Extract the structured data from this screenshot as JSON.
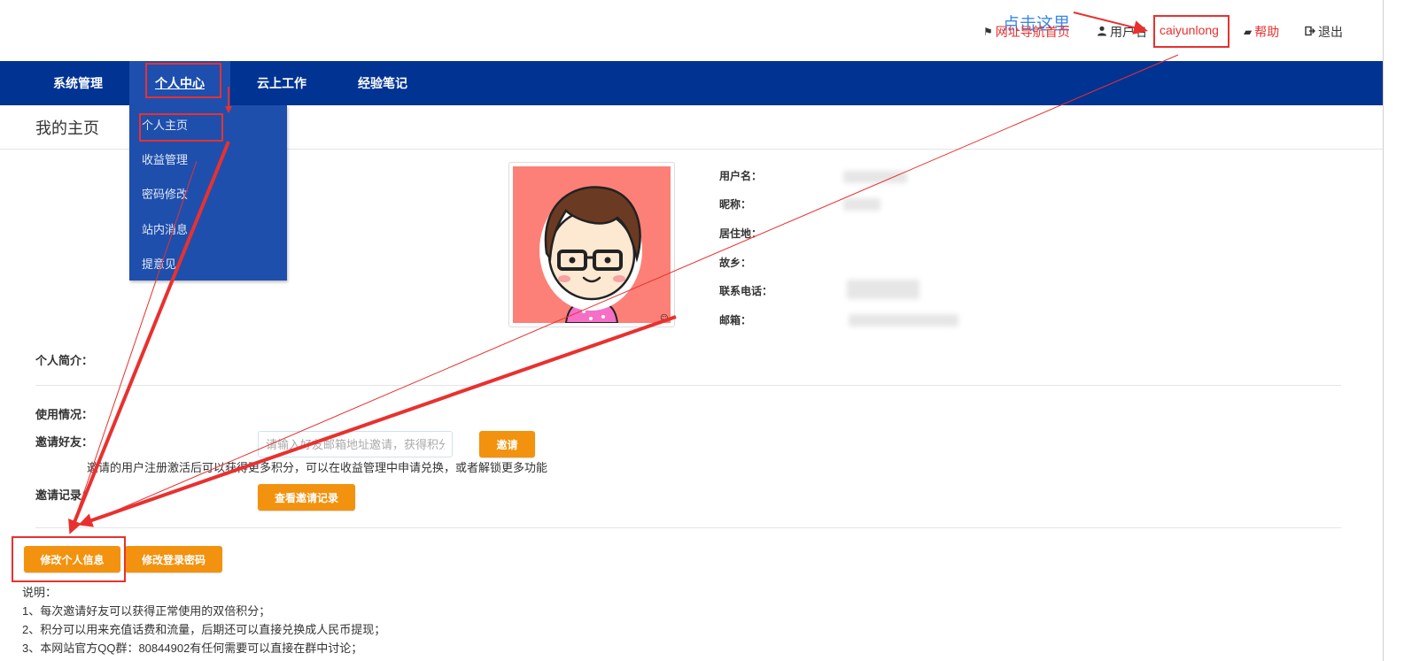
{
  "annotation": {
    "click_here": "点击这里"
  },
  "topbar": {
    "nav_link": "网址导航首页",
    "username_label": "用户名",
    "username": "caiyunlong",
    "help": "帮助",
    "logout": "退出",
    "icons": {
      "nav": "flag-icon",
      "user": "user-icon",
      "help": "book-icon",
      "logout": "logout-icon"
    }
  },
  "navbar": {
    "items": [
      {
        "label": "系统管理"
      },
      {
        "label": "个人中心"
      },
      {
        "label": "云上工作"
      },
      {
        "label": "经验笔记"
      }
    ],
    "active": "个人中心"
  },
  "dropdown": {
    "items": [
      {
        "label": "个人主页"
      },
      {
        "label": "收益管理"
      },
      {
        "label": "密码修改"
      },
      {
        "label": "站内消息"
      },
      {
        "label": "提意见"
      }
    ]
  },
  "page": {
    "title": "我的主页"
  },
  "profile": {
    "fields": [
      {
        "label": "用户名："
      },
      {
        "label": "昵称："
      },
      {
        "label": "居住地："
      },
      {
        "label": "故乡："
      },
      {
        "label": "联系电话："
      },
      {
        "label": "邮箱："
      }
    ],
    "bio_label": "个人简介："
  },
  "usage": {
    "label": "使用情况：",
    "invite_label": "邀请好友：",
    "invite_placeholder": "请输入好友邮箱地址邀请，获得积分",
    "invite_button": "邀请",
    "invite_hint": "邀请的用户注册激活后可以获得更多积分，可以在收益管理中申请兑换，或者解锁更多功能",
    "record_label": "邀请记录：",
    "record_button": "查看邀请记录"
  },
  "actions": {
    "edit_info": "修改个人信息",
    "edit_password": "修改登录密码"
  },
  "notes": {
    "title": "说明：",
    "lines": [
      "1、每次邀请好友可以获得正常使用的双倍积分；",
      "2、积分可以用来充值话费和流量，后期还可以直接兑换成人民币提现；",
      "3、本网站官方QQ群：80844902有任何需要可以直接在群中讨论；"
    ]
  },
  "colors": {
    "navbar": "#013393",
    "dropdown": "#1f4fad",
    "accent_orange": "#f2920e",
    "annotation_red": "#e8312f",
    "annotation_blue": "#3b88e6",
    "avatar_bg": "#fd8078"
  }
}
